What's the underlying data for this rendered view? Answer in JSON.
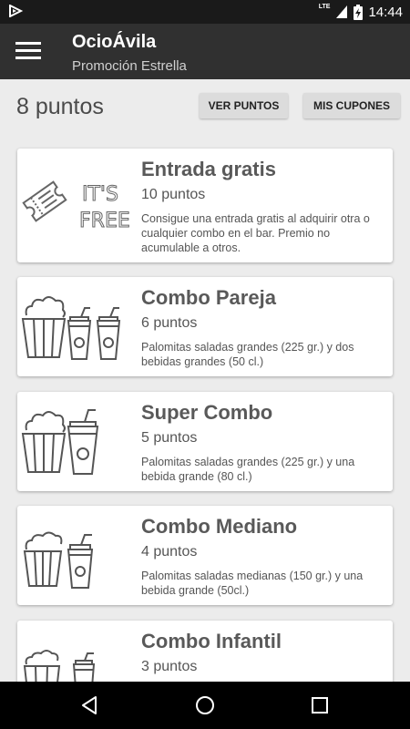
{
  "status_bar": {
    "network": "LTE",
    "time": "14:44"
  },
  "app_bar": {
    "title": "OcioÁvila",
    "subtitle": "Promoción Estrella"
  },
  "points": {
    "label": "8 puntos",
    "view_points_button": "VER PUNTOS",
    "my_coupons_button": "MIS CUPONES"
  },
  "promotions": [
    {
      "title": "Entrada gratis",
      "points": "10 puntos",
      "description": "Consigue una entrada gratis al adquirir otra o cualquier combo en el bar. Premio no acumulable a otros.",
      "illustration_text": [
        "IT'S",
        "FREE!"
      ],
      "icon": "ticket-its-free-icon"
    },
    {
      "title": "Combo Pareja",
      "points": "6 puntos",
      "description": "Palomitas saladas grandes (225 gr.) y dos bebidas grandes (50 cl.)",
      "icon": "popcorn-two-drinks-icon"
    },
    {
      "title": "Super Combo",
      "points": "5 puntos",
      "description": "Palomitas saladas grandes (225 gr.) y una bebida grande (80 cl.)",
      "icon": "popcorn-big-drink-icon"
    },
    {
      "title": "Combo Mediano",
      "points": "4 puntos",
      "description": "Palomitas saladas medianas (150 gr.) y una bebida grande (50cl.)",
      "icon": "popcorn-drink-icon"
    },
    {
      "title": "Combo Infantil",
      "points": "3 puntos",
      "description": "",
      "icon": "popcorn-small-drink-icon"
    }
  ],
  "colors": {
    "status_bar": "#1a1a1a",
    "app_bar": "#303030",
    "background": "#ececec",
    "card_title": "#595959",
    "button": "#dcdcdc",
    "nav_bar": "#000000"
  }
}
